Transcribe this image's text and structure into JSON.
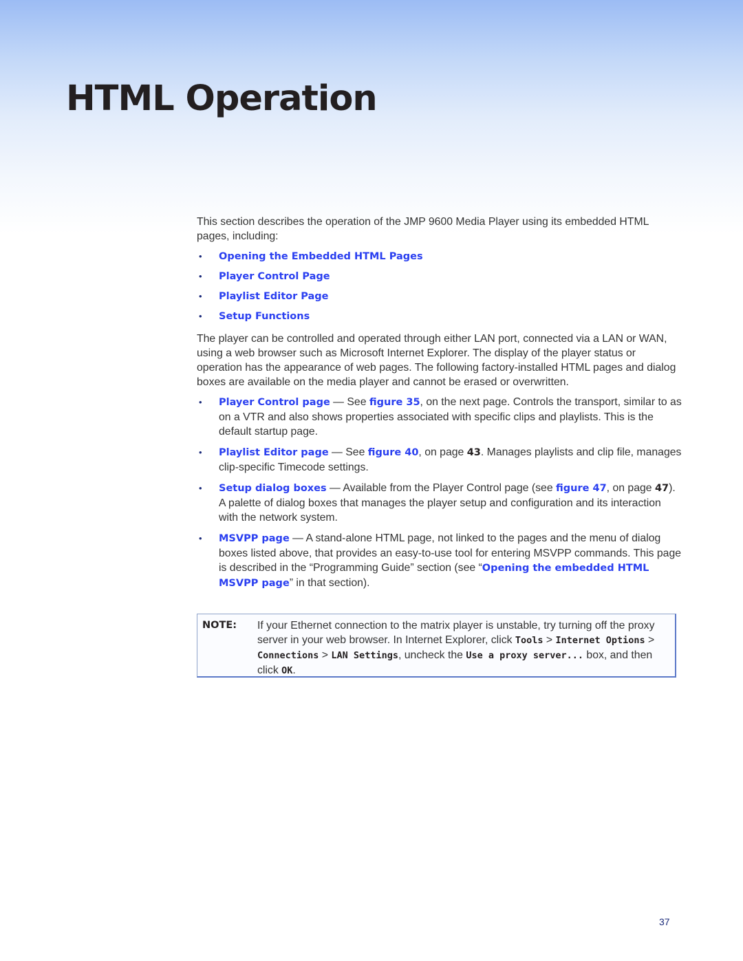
{
  "header": {
    "title": "HTML Operation"
  },
  "intro": "This section describes the operation of the JMP 9600 Media Player using its embedded HTML pages, including:",
  "toc": [
    {
      "label": "Opening the Embedded HTML Pages"
    },
    {
      "label": "Player Control Page"
    },
    {
      "label": "Playlist Editor Page"
    },
    {
      "label": "Setup Functions"
    }
  ],
  "bullet_glyph": "•",
  "overview": "The player can be controlled and operated through either LAN port, connected via a LAN or WAN, using a web browser such as Microsoft Internet Explorer. The display of the player status or operation has the appearance of web pages. The following factory-installed HTML pages and dialog boxes are available on the media player and cannot be erased or overwritten.",
  "pages": [
    {
      "name": "Player Control page",
      "sep": " — See ",
      "fig": "figure 35",
      "text": ", on the next page. Controls the transport, similar to as on a VTR and also shows properties associated with specific clips and playlists. This is the default startup page."
    },
    {
      "name": "Playlist Editor page",
      "sep": " — See ",
      "fig": "figure 40",
      "mid": ", on page ",
      "page": "43",
      "text": ". Manages playlists and clip file, manages clip-specific Timecode settings."
    },
    {
      "name": "Setup dialog boxes",
      "sep": " — Available from the Player Control page (see ",
      "fig": "figure 47",
      "mid": ", on page ",
      "page": "47",
      "text": "). A palette of dialog boxes that manages the player setup and configuration and its interaction with the network system."
    },
    {
      "name": "MSVPP page",
      "sep": " — A stand-alone HTML page, not linked to the pages and the menu of dialog boxes listed above, that provides an easy-to-use tool for entering MSVPP commands. This page is described in the “Programming Guide” section (see “",
      "fig": "Opening the embedded HTML MSVPP page",
      "text": "” in that section)."
    }
  ],
  "note": {
    "label": "NOTE:",
    "t1": "If your Ethernet connection to the matrix player is unstable, try turning off the proxy server in your web browser. In Internet Explorer, click ",
    "c1": "Tools",
    "gt": " > ",
    "c2": "Internet Options",
    "c3": "Connections",
    "c4": "LAN Settings",
    "t2": ", uncheck the ",
    "c5": "Use a proxy server...",
    "t3": " box, and then click ",
    "c6": "OK",
    "t4": "."
  },
  "footer": {
    "page_number": "37"
  },
  "colors": {
    "link": "#2a3ff0",
    "bullet": "#1a2a7a",
    "gradient_top": "#9cbcf4"
  }
}
